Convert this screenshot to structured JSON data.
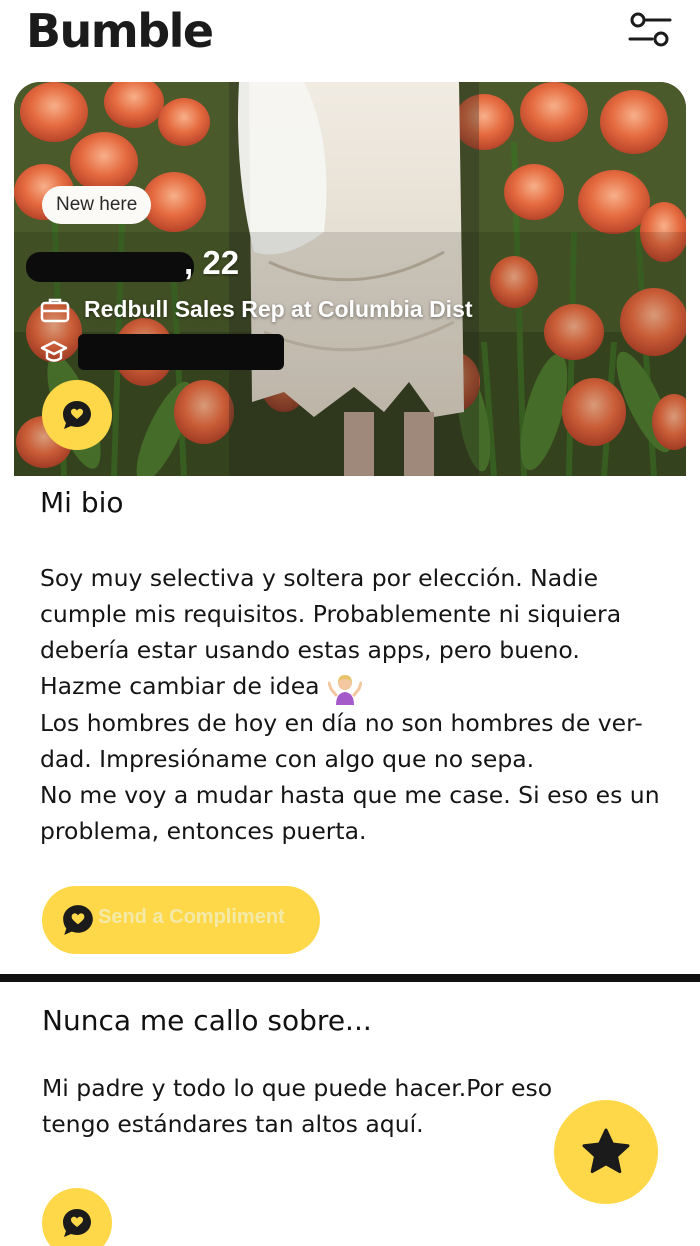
{
  "app": {
    "logo_text": "Bumble"
  },
  "header": {
    "filter_icon": "sliders-icon"
  },
  "profile": {
    "badge": "New here",
    "age_text": ", 22",
    "job": "Redbull Sales Rep at Columbia Dist",
    "job_icon": "briefcase-icon",
    "education_icon": "graduation-cap-icon"
  },
  "bio": {
    "title": "Mi bio",
    "lines": [
      "Soy muy selectiva y soltera por elección. Nadie",
      "cumple mis requisitos. Probablemente ni siquiera",
      "debería estar usando estas apps, pero bueno.",
      "Hazme cambiar de idea",
      "Los hombres de hoy en día no son hombres de ver-",
      "dad. Impresióname con algo que no sepa.",
      "No me voy a mudar hasta que me case. Si eso es un",
      "problema, entonces puerta."
    ],
    "emoji_icon": "person-shrugging-emoji"
  },
  "compliment": {
    "label": "Send a Compliment",
    "icon": "compliment-bubble-icon"
  },
  "prompt": {
    "title": "Nunca me callo sobre...",
    "answer_lines": [
      "Mi padre y todo lo que puede hacer.Por eso",
      "tengo estándares tan altos aquí."
    ]
  },
  "actions": {
    "superswipe_icon": "star-icon"
  },
  "colors": {
    "accent_yellow": "#ffd84a",
    "text_dark": "#1c1c1c",
    "background": "#ffffff"
  }
}
